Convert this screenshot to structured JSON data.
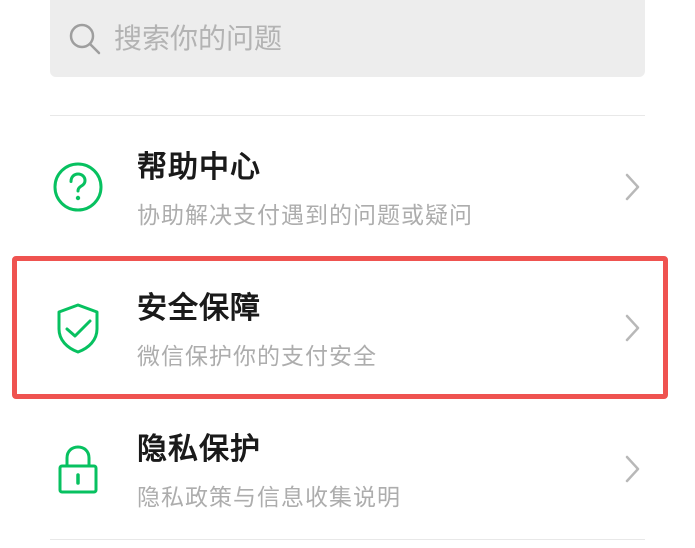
{
  "search": {
    "placeholder": "搜索你的问题",
    "icon": "search-icon"
  },
  "menu": {
    "items": [
      {
        "title": "帮助中心",
        "description": "协助解决支付遇到的问题或疑问",
        "icon": "help-circle-icon"
      },
      {
        "title": "安全保障",
        "description": "微信保护你的支付安全",
        "icon": "shield-check-icon",
        "highlighted": true
      },
      {
        "title": "隐私保护",
        "description": "隐私政策与信息收集说明",
        "icon": "lock-icon"
      }
    ]
  },
  "colors": {
    "accent": "#07c160",
    "highlight_border": "#ef5350",
    "title_text": "#1a1a1a",
    "secondary_text": "#adadad",
    "search_background": "#ededed"
  }
}
